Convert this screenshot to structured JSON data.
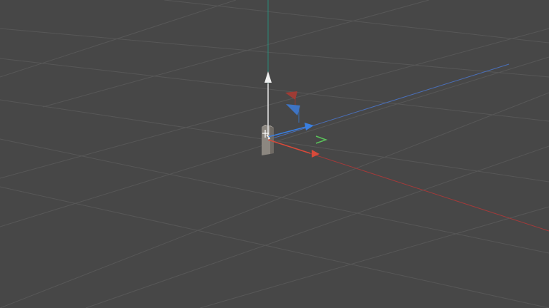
{
  "viewport": {
    "background": "#474747",
    "grid_color": "#575757",
    "axes": {
      "x_color": "#a33a3a",
      "y_color": "#4a6fb8",
      "z_color": "#2a8a7a"
    }
  },
  "object": {
    "type": "box",
    "fill": "#8c8780"
  },
  "gizmo": {
    "mode": "translate",
    "colors": {
      "up": "#e8e8e8",
      "x": "#d84a3a",
      "y": "#3a7fe0",
      "z": "#5ac25a"
    },
    "icons": {
      "pivot": "pivot-icon",
      "rotate_red": "rotate-handle-red",
      "rotate_blue": "rotate-handle-blue"
    }
  }
}
